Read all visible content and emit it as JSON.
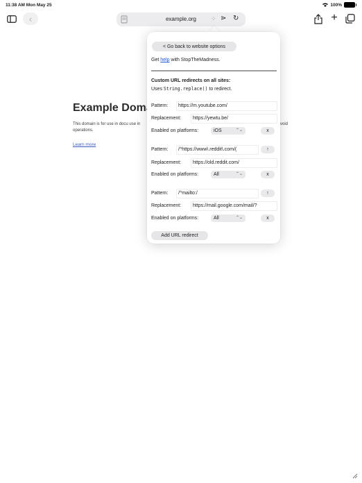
{
  "status_bar": {
    "time": "11:38 AM  Mon May 25",
    "wifi": "wifi-icon",
    "battery_percent": "100%"
  },
  "toolbar": {
    "domain": "example.org"
  },
  "webpage": {
    "title": "Example Doma",
    "description": "This domain is for use in docu use in operations.",
    "description_right": "void",
    "link": "Learn more"
  },
  "popup": {
    "go_back_label": "< Go back to website options",
    "help_prefix": "Get ",
    "help_link": "help",
    "help_suffix": " with StopTheMadness.",
    "section_title": "Custom URL redirects on all sites:",
    "section_sub_prefix": "Uses ",
    "section_sub_code": "String.replace()",
    "section_sub_suffix": " to redirect.",
    "labels": {
      "pattern": "Pattern:",
      "replacement": "Replacement:",
      "enabled": "Enabled on platforms:"
    },
    "redirects": [
      {
        "pattern": "https://m.youtube.com/",
        "replacement": "https://yewtu.be/",
        "platform": "iOS",
        "action": "x"
      },
      {
        "pattern": "/^https://www\\.reddit\\.com/(",
        "replacement": "https://old.reddit.com/",
        "platform": "All",
        "action": "x",
        "move": "↑"
      },
      {
        "pattern": "/^mailto:/",
        "replacement": "https://mail.google.com/mail/?",
        "platform": "All",
        "action": "x",
        "move": "↑"
      }
    ],
    "add_label": "Add URL redirect"
  }
}
